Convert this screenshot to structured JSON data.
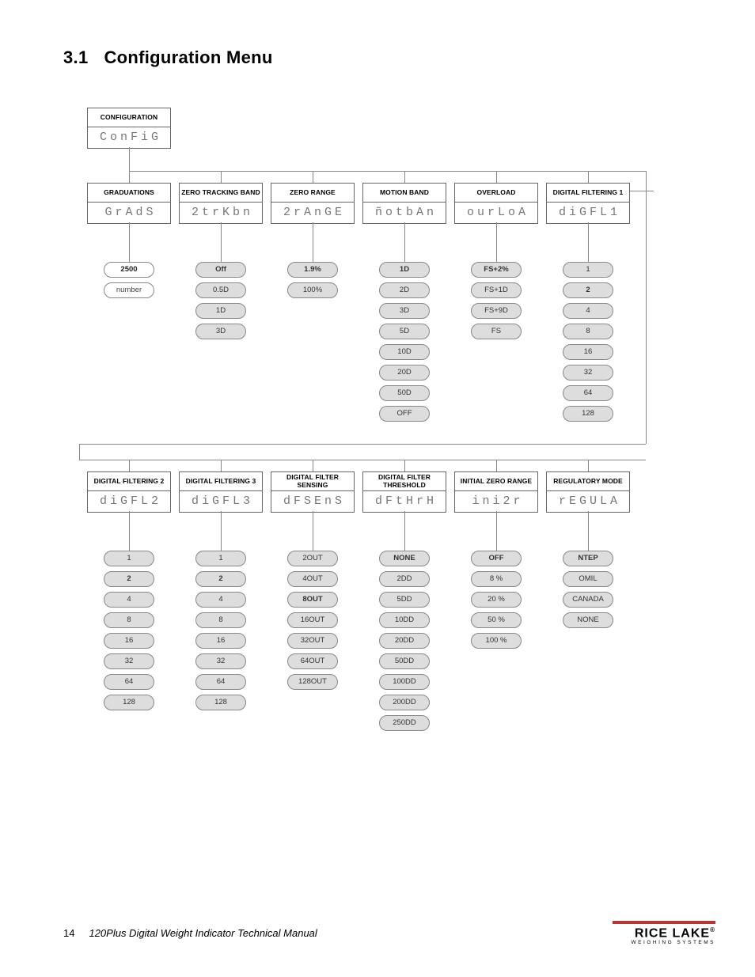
{
  "heading": {
    "number": "3.1",
    "title": "Configuration Menu"
  },
  "root": {
    "label": "CONFIGURATION",
    "seg": "ConFiG"
  },
  "row1": [
    {
      "label": "GRADUATIONS",
      "seg": "GrAdS"
    },
    {
      "label": "ZERO TRACKING BAND",
      "seg": "2trKbn"
    },
    {
      "label": "ZERO RANGE",
      "seg": "2rAnGE"
    },
    {
      "label": "MOTION BAND",
      "seg": "ñotbAn"
    },
    {
      "label": "OVERLOAD",
      "seg": "ourLoA"
    },
    {
      "label": "DIGITAL FILTERING 1",
      "seg": "diGFL1"
    }
  ],
  "row2": [
    {
      "label": "DIGITAL FILTERING 2",
      "seg": "diGFL2"
    },
    {
      "label": "DIGITAL FILTERING 3",
      "seg": "diGFL3"
    },
    {
      "label": "DIGITAL FILTER SENSING",
      "seg": "dFSEnS"
    },
    {
      "label": "DIGITAL FILTER THRESHOLD",
      "seg": "dFtHrH"
    },
    {
      "label": "INITIAL ZERO RANGE",
      "seg": "ini2r"
    },
    {
      "label": "REGULATORY MODE",
      "seg": "rEGULA"
    }
  ],
  "opts_row1": [
    {
      "items": [
        "2500",
        "number"
      ],
      "sel": 0,
      "grey": []
    },
    {
      "items": [
        "Off",
        "0.5D",
        "1D",
        "3D"
      ],
      "sel": 0,
      "grey": [
        0,
        1,
        2,
        3
      ]
    },
    {
      "items": [
        "1.9%",
        "100%"
      ],
      "sel": 0,
      "grey": [
        0,
        1
      ]
    },
    {
      "items": [
        "1D",
        "2D",
        "3D",
        "5D",
        "10D",
        "20D",
        "50D",
        "OFF"
      ],
      "sel": 0,
      "grey": [
        0,
        1,
        2,
        3,
        4,
        5,
        6,
        7
      ]
    },
    {
      "items": [
        "FS+2%",
        "FS+1D",
        "FS+9D",
        "FS"
      ],
      "sel": 0,
      "grey": [
        0,
        1,
        2,
        3
      ]
    },
    {
      "items": [
        "1",
        "2",
        "4",
        "8",
        "16",
        "32",
        "64",
        "128"
      ],
      "sel": 1,
      "grey": [
        0,
        1,
        2,
        3,
        4,
        5,
        6,
        7
      ]
    }
  ],
  "opts_row2": [
    {
      "items": [
        "1",
        "2",
        "4",
        "8",
        "16",
        "32",
        "64",
        "128"
      ],
      "sel": 1,
      "grey": [
        0,
        1,
        2,
        3,
        4,
        5,
        6,
        7
      ]
    },
    {
      "items": [
        "1",
        "2",
        "4",
        "8",
        "16",
        "32",
        "64",
        "128"
      ],
      "sel": 1,
      "grey": [
        0,
        1,
        2,
        3,
        4,
        5,
        6,
        7
      ]
    },
    {
      "items": [
        "2OUT",
        "4OUT",
        "8OUT",
        "16OUT",
        "32OUT",
        "64OUT",
        "128OUT"
      ],
      "sel": 2,
      "grey": [
        0,
        1,
        2,
        3,
        4,
        5,
        6
      ]
    },
    {
      "items": [
        "NONE",
        "2DD",
        "5DD",
        "10DD",
        "20DD",
        "50DD",
        "100DD",
        "200DD",
        "250DD"
      ],
      "sel": 0,
      "grey": [
        0,
        1,
        2,
        3,
        4,
        5,
        6,
        7,
        8
      ]
    },
    {
      "items": [
        "OFF",
        "8 %",
        "20 %",
        "50 %",
        "100 %"
      ],
      "sel": 0,
      "grey": [
        0,
        1,
        2,
        3,
        4
      ]
    },
    {
      "items": [
        "NTEP",
        "OMIL",
        "CANADA",
        "NONE"
      ],
      "sel": 0,
      "grey": [
        0,
        1,
        2,
        3
      ]
    }
  ],
  "footer": {
    "page": "14",
    "title": "120Plus Digital Weight Indicator Technical Manual",
    "brand": "RICE LAKE",
    "tagline": "WEIGHING SYSTEMS"
  },
  "chart_data": null
}
